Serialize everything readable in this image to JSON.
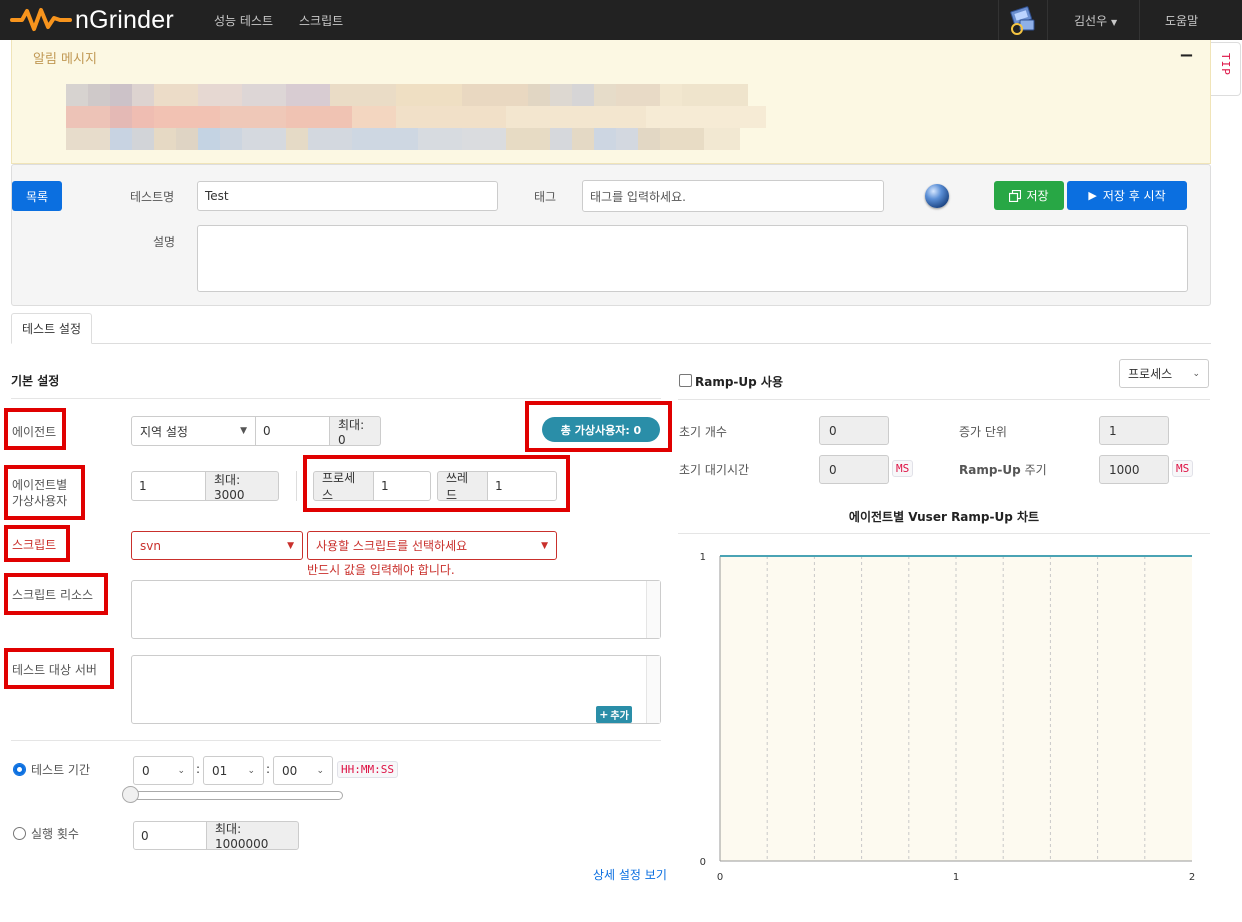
{
  "app": {
    "name": "nGrinder",
    "nav": [
      "성능 테스트",
      "스크립트"
    ],
    "user": "김선우",
    "help": "도움말"
  },
  "alert": {
    "title": "알림 메시지",
    "collapse": "−",
    "tip": "TIP"
  },
  "header": {
    "list_button": "목록",
    "test_name_label": "테스트명",
    "test_name_value": "Test",
    "tag_label": "태그",
    "tag_placeholder": "태그를 입력하세요.",
    "save_button": "저장",
    "save_run_button": "저장 후 시작",
    "description_label": "설명"
  },
  "tabs": [
    "테스트 설정"
  ],
  "basic": {
    "title": "기본 설정",
    "agent_label": "에이전트",
    "region_select": "지역 설정",
    "agent_count": "0",
    "agent_max": "최대: 0",
    "total_vusers": "총 가상사용자: 0",
    "vuser_label_1": "에이전트별",
    "vuser_label_2": "가상사용자",
    "vuser_value": "1",
    "vuser_max": "최대: 3000",
    "process_label": "프로세스",
    "process_value": "1",
    "thread_label": "쓰레드",
    "thread_value": "1",
    "script_label": "스크립트",
    "script_repo": "svn",
    "script_select": "사용할 스크립트를 선택하세요",
    "script_error": "반드시 값을 입력해야 합니다.",
    "resource_label": "스크립트 리소스",
    "target_label": "테스트 대상 서버",
    "add_button": "추가",
    "duration_label": "테스트 기간",
    "duration_hours": "0",
    "duration_minutes": "01",
    "duration_seconds": "00",
    "duration_sep": ":",
    "duration_format": "HH:MM:SS",
    "duration_selected": true,
    "runcount_label": "실행 횟수",
    "runcount_value": "0",
    "runcount_max": "최대: 1000000",
    "advanced_link": "상세 설정 보기"
  },
  "rampup": {
    "enable_label": "Ramp-Up 사용",
    "enabled": false,
    "type_select": "프로세스",
    "init_count_label": "초기 개수",
    "init_count_value": "0",
    "step_label": "증가 단위",
    "step_value": "1",
    "init_sleep_label": "초기 대기시간",
    "init_sleep_value": "0",
    "ms_unit": "MS",
    "interval_label_bold": "Ramp-Up",
    "interval_label_rest": " 주기",
    "interval_value": "1000"
  },
  "chart_data": {
    "type": "line",
    "title": "에이전트별 Vuser Ramp-Up 차트",
    "x": [
      0,
      2
    ],
    "series": [
      {
        "values": [
          1,
          1
        ],
        "color": "#4aa3b4"
      }
    ],
    "xticks": [
      "0",
      "1",
      "2"
    ],
    "yticks": [
      "0",
      "1"
    ],
    "xlim": [
      0,
      2
    ],
    "ylim": [
      0,
      1
    ],
    "background": "#fdfaf0"
  }
}
